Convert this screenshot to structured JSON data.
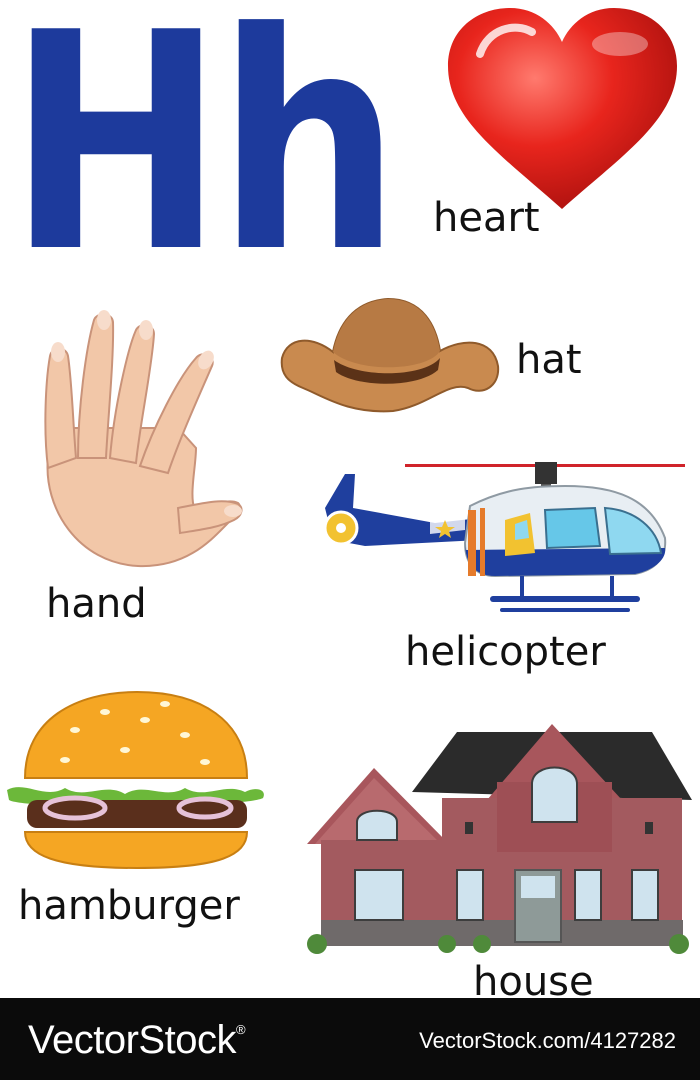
{
  "title_letters": "Hh",
  "items": {
    "heart": {
      "label": "heart"
    },
    "hat": {
      "label": "hat"
    },
    "hand": {
      "label": "hand"
    },
    "helicopter": {
      "label": "helicopter"
    },
    "hamburger": {
      "label": "hamburger"
    },
    "house": {
      "label": "house"
    }
  },
  "footer": {
    "brand": "VectorStock",
    "trademark": "®",
    "image_id": "VectorStock.com/4127282"
  },
  "colors": {
    "letter": "#1d3a9c",
    "heart": "#e3201b",
    "footer_bg": "#0b0b0b"
  }
}
